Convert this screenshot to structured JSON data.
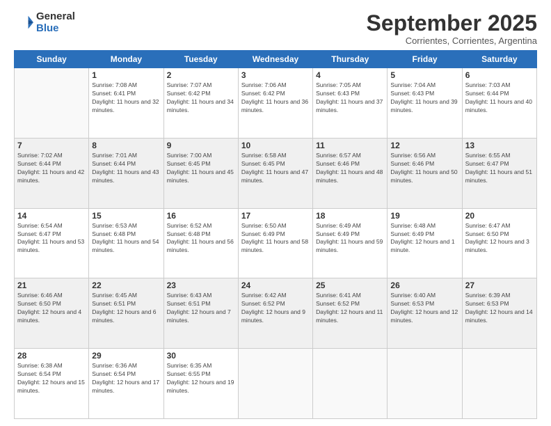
{
  "logo": {
    "general": "General",
    "blue": "Blue"
  },
  "header": {
    "month": "September 2025",
    "location": "Corrientes, Corrientes, Argentina"
  },
  "days_of_week": [
    "Sunday",
    "Monday",
    "Tuesday",
    "Wednesday",
    "Thursday",
    "Friday",
    "Saturday"
  ],
  "weeks": [
    [
      {
        "day": "",
        "sunrise": "",
        "sunset": "",
        "daylight": ""
      },
      {
        "day": "1",
        "sunrise": "Sunrise: 7:08 AM",
        "sunset": "Sunset: 6:41 PM",
        "daylight": "Daylight: 11 hours and 32 minutes."
      },
      {
        "day": "2",
        "sunrise": "Sunrise: 7:07 AM",
        "sunset": "Sunset: 6:42 PM",
        "daylight": "Daylight: 11 hours and 34 minutes."
      },
      {
        "day": "3",
        "sunrise": "Sunrise: 7:06 AM",
        "sunset": "Sunset: 6:42 PM",
        "daylight": "Daylight: 11 hours and 36 minutes."
      },
      {
        "day": "4",
        "sunrise": "Sunrise: 7:05 AM",
        "sunset": "Sunset: 6:43 PM",
        "daylight": "Daylight: 11 hours and 37 minutes."
      },
      {
        "day": "5",
        "sunrise": "Sunrise: 7:04 AM",
        "sunset": "Sunset: 6:43 PM",
        "daylight": "Daylight: 11 hours and 39 minutes."
      },
      {
        "day": "6",
        "sunrise": "Sunrise: 7:03 AM",
        "sunset": "Sunset: 6:44 PM",
        "daylight": "Daylight: 11 hours and 40 minutes."
      }
    ],
    [
      {
        "day": "7",
        "sunrise": "Sunrise: 7:02 AM",
        "sunset": "Sunset: 6:44 PM",
        "daylight": "Daylight: 11 hours and 42 minutes."
      },
      {
        "day": "8",
        "sunrise": "Sunrise: 7:01 AM",
        "sunset": "Sunset: 6:44 PM",
        "daylight": "Daylight: 11 hours and 43 minutes."
      },
      {
        "day": "9",
        "sunrise": "Sunrise: 7:00 AM",
        "sunset": "Sunset: 6:45 PM",
        "daylight": "Daylight: 11 hours and 45 minutes."
      },
      {
        "day": "10",
        "sunrise": "Sunrise: 6:58 AM",
        "sunset": "Sunset: 6:45 PM",
        "daylight": "Daylight: 11 hours and 47 minutes."
      },
      {
        "day": "11",
        "sunrise": "Sunrise: 6:57 AM",
        "sunset": "Sunset: 6:46 PM",
        "daylight": "Daylight: 11 hours and 48 minutes."
      },
      {
        "day": "12",
        "sunrise": "Sunrise: 6:56 AM",
        "sunset": "Sunset: 6:46 PM",
        "daylight": "Daylight: 11 hours and 50 minutes."
      },
      {
        "day": "13",
        "sunrise": "Sunrise: 6:55 AM",
        "sunset": "Sunset: 6:47 PM",
        "daylight": "Daylight: 11 hours and 51 minutes."
      }
    ],
    [
      {
        "day": "14",
        "sunrise": "Sunrise: 6:54 AM",
        "sunset": "Sunset: 6:47 PM",
        "daylight": "Daylight: 11 hours and 53 minutes."
      },
      {
        "day": "15",
        "sunrise": "Sunrise: 6:53 AM",
        "sunset": "Sunset: 6:48 PM",
        "daylight": "Daylight: 11 hours and 54 minutes."
      },
      {
        "day": "16",
        "sunrise": "Sunrise: 6:52 AM",
        "sunset": "Sunset: 6:48 PM",
        "daylight": "Daylight: 11 hours and 56 minutes."
      },
      {
        "day": "17",
        "sunrise": "Sunrise: 6:50 AM",
        "sunset": "Sunset: 6:49 PM",
        "daylight": "Daylight: 11 hours and 58 minutes."
      },
      {
        "day": "18",
        "sunrise": "Sunrise: 6:49 AM",
        "sunset": "Sunset: 6:49 PM",
        "daylight": "Daylight: 11 hours and 59 minutes."
      },
      {
        "day": "19",
        "sunrise": "Sunrise: 6:48 AM",
        "sunset": "Sunset: 6:49 PM",
        "daylight": "Daylight: 12 hours and 1 minute."
      },
      {
        "day": "20",
        "sunrise": "Sunrise: 6:47 AM",
        "sunset": "Sunset: 6:50 PM",
        "daylight": "Daylight: 12 hours and 3 minutes."
      }
    ],
    [
      {
        "day": "21",
        "sunrise": "Sunrise: 6:46 AM",
        "sunset": "Sunset: 6:50 PM",
        "daylight": "Daylight: 12 hours and 4 minutes."
      },
      {
        "day": "22",
        "sunrise": "Sunrise: 6:45 AM",
        "sunset": "Sunset: 6:51 PM",
        "daylight": "Daylight: 12 hours and 6 minutes."
      },
      {
        "day": "23",
        "sunrise": "Sunrise: 6:43 AM",
        "sunset": "Sunset: 6:51 PM",
        "daylight": "Daylight: 12 hours and 7 minutes."
      },
      {
        "day": "24",
        "sunrise": "Sunrise: 6:42 AM",
        "sunset": "Sunset: 6:52 PM",
        "daylight": "Daylight: 12 hours and 9 minutes."
      },
      {
        "day": "25",
        "sunrise": "Sunrise: 6:41 AM",
        "sunset": "Sunset: 6:52 PM",
        "daylight": "Daylight: 12 hours and 11 minutes."
      },
      {
        "day": "26",
        "sunrise": "Sunrise: 6:40 AM",
        "sunset": "Sunset: 6:53 PM",
        "daylight": "Daylight: 12 hours and 12 minutes."
      },
      {
        "day": "27",
        "sunrise": "Sunrise: 6:39 AM",
        "sunset": "Sunset: 6:53 PM",
        "daylight": "Daylight: 12 hours and 14 minutes."
      }
    ],
    [
      {
        "day": "28",
        "sunrise": "Sunrise: 6:38 AM",
        "sunset": "Sunset: 6:54 PM",
        "daylight": "Daylight: 12 hours and 15 minutes."
      },
      {
        "day": "29",
        "sunrise": "Sunrise: 6:36 AM",
        "sunset": "Sunset: 6:54 PM",
        "daylight": "Daylight: 12 hours and 17 minutes."
      },
      {
        "day": "30",
        "sunrise": "Sunrise: 6:35 AM",
        "sunset": "Sunset: 6:55 PM",
        "daylight": "Daylight: 12 hours and 19 minutes."
      },
      {
        "day": "",
        "sunrise": "",
        "sunset": "",
        "daylight": ""
      },
      {
        "day": "",
        "sunrise": "",
        "sunset": "",
        "daylight": ""
      },
      {
        "day": "",
        "sunrise": "",
        "sunset": "",
        "daylight": ""
      },
      {
        "day": "",
        "sunrise": "",
        "sunset": "",
        "daylight": ""
      }
    ]
  ]
}
